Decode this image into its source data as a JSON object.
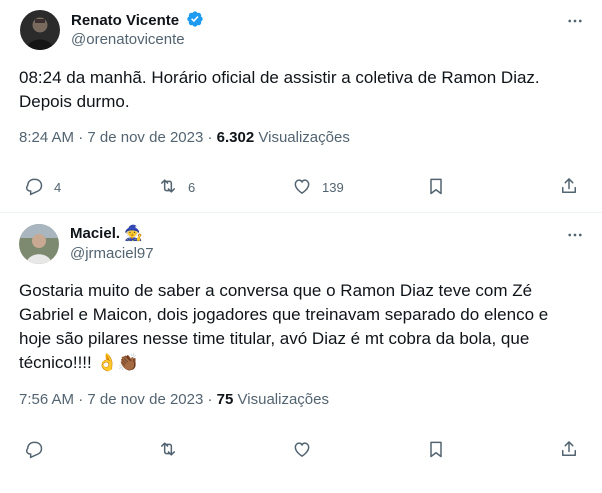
{
  "tweets": [
    {
      "name": "Renato Vicente",
      "handle": "@orenatovicente",
      "verified": true,
      "text_lines": [
        "08:24 da manhã. Horário oficial de assistir a coletiva de Ramon Diaz.",
        "Depois durmo."
      ],
      "time": "8:24 AM",
      "date": "7 de nov de 2023",
      "views_count": "6.302",
      "views_label": "Visualizações",
      "replies": "4",
      "retweets": "6",
      "likes": "139"
    },
    {
      "name": "Maciel.",
      "name_emoji": "🧙",
      "handle": "@jrmaciel97",
      "text_lines": [
        "Gostaria muito de saber a conversa que o Ramon Diaz teve com Zé",
        "Gabriel e Maicon, dois jogadores que treinavam separado do elenco e",
        "hoje são pilares nesse time titular, avó Diaz é mt cobra da bola, que",
        "técnico!!!! 👌👏🏾"
      ],
      "time": "7:56 AM",
      "date": "7 de nov de 2023",
      "views_count": "75",
      "views_label": "Visualizações"
    }
  ],
  "separator": "·",
  "icons": {
    "verified": "verified-badge-icon",
    "more": "more-dots-icon",
    "reply": "reply-icon",
    "retweet": "retweet-icon",
    "like": "heart-icon",
    "bookmark": "bookmark-icon",
    "share": "share-icon"
  },
  "colors": {
    "accent": "#1d9bf0",
    "text": "#0f1419",
    "secondary": "#536471",
    "border": "#eff3f4"
  }
}
